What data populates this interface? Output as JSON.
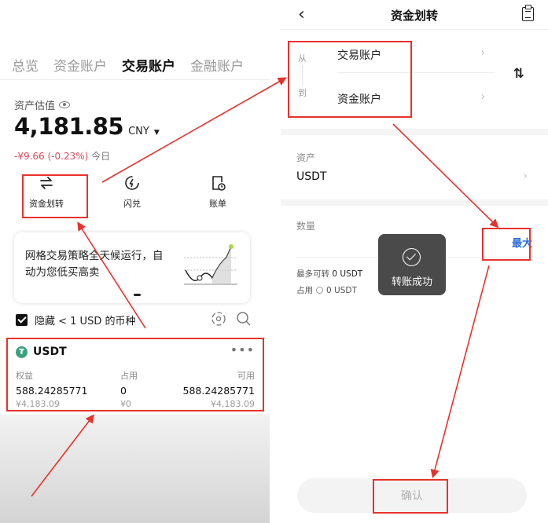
{
  "left": {
    "tabs": [
      {
        "label": "总览",
        "active": false
      },
      {
        "label": "资金账户",
        "active": false
      },
      {
        "label": "交易账户",
        "active": true
      },
      {
        "label": "金融账户",
        "active": false
      }
    ],
    "estimate_label": "资产估值",
    "balance": "4,181.85",
    "currency": "CNY",
    "change": "-¥9.66 (-0.23%)",
    "change_suffix": "今日",
    "actions": [
      {
        "label": "资金划转",
        "icon": "swap-arrows-icon"
      },
      {
        "label": "闪兑",
        "icon": "flash-convert-icon"
      },
      {
        "label": "账单",
        "icon": "bill-icon"
      }
    ],
    "promo_text": "网格交易策略全天候运行，自动为您低买高卖",
    "hide_small": "隐藏 < 1 USD 的币种",
    "asset": {
      "name": "USDT",
      "columns": [
        {
          "header": "权益",
          "value": "588.24285771",
          "sub": "¥4,183.09"
        },
        {
          "header": "占用",
          "value": "0",
          "sub": "¥0"
        },
        {
          "header": "可用",
          "value": "588.24285771",
          "sub": "¥4,183.09"
        }
      ]
    }
  },
  "right": {
    "title": "资金划转",
    "from_label": "从",
    "from_account": "交易账户",
    "to_label": "到",
    "to_account": "资金账户",
    "asset_label": "资产",
    "asset_value": "USDT",
    "quantity_label": "数量",
    "max_label": "最大",
    "available_label": "最多可转",
    "available_value": "0 USDT",
    "occupied_label": "占用",
    "occupied_value": "0 USDT",
    "toast": "转账成功",
    "confirm": "确认"
  },
  "colors": {
    "highlight": "#e8322c",
    "negative": "#e0495c",
    "accent": "#2f6ee0",
    "tether": "#3aa17d"
  }
}
